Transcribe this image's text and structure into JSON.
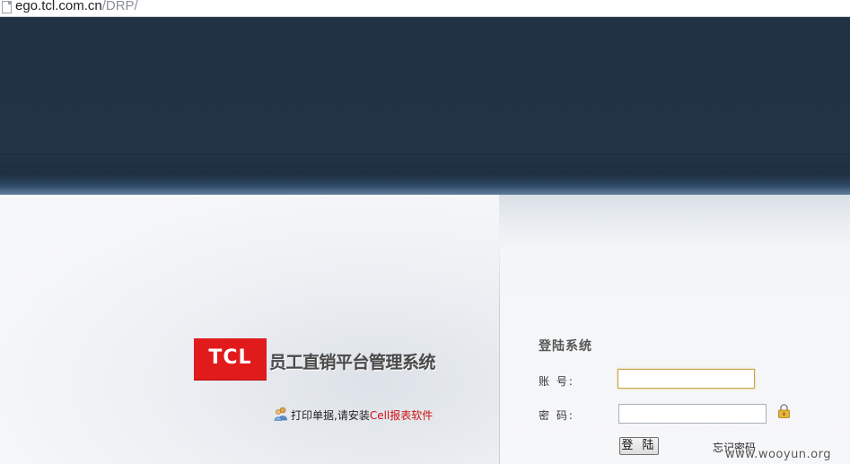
{
  "browser": {
    "url_domain": "ego.tcl.com.cn",
    "url_path": "/DRP/"
  },
  "logo": {
    "brand": "TCL",
    "system_title": "员工直销平台管理系统"
  },
  "print_hint": {
    "text": "打印单据,请安装",
    "link_text": "Cell报表软件"
  },
  "login": {
    "title": "登陆系统",
    "account_label": "账 号:",
    "account_value": "",
    "password_label": "密 码:",
    "password_value": "",
    "submit_label": "登 陆",
    "forgot_label": "忘记密码"
  },
  "watermark": {
    "text": "www.wooyun.org"
  },
  "colors": {
    "header_navy": "#203244",
    "brand_red": "#e11b1b",
    "link_red": "#d01010"
  }
}
